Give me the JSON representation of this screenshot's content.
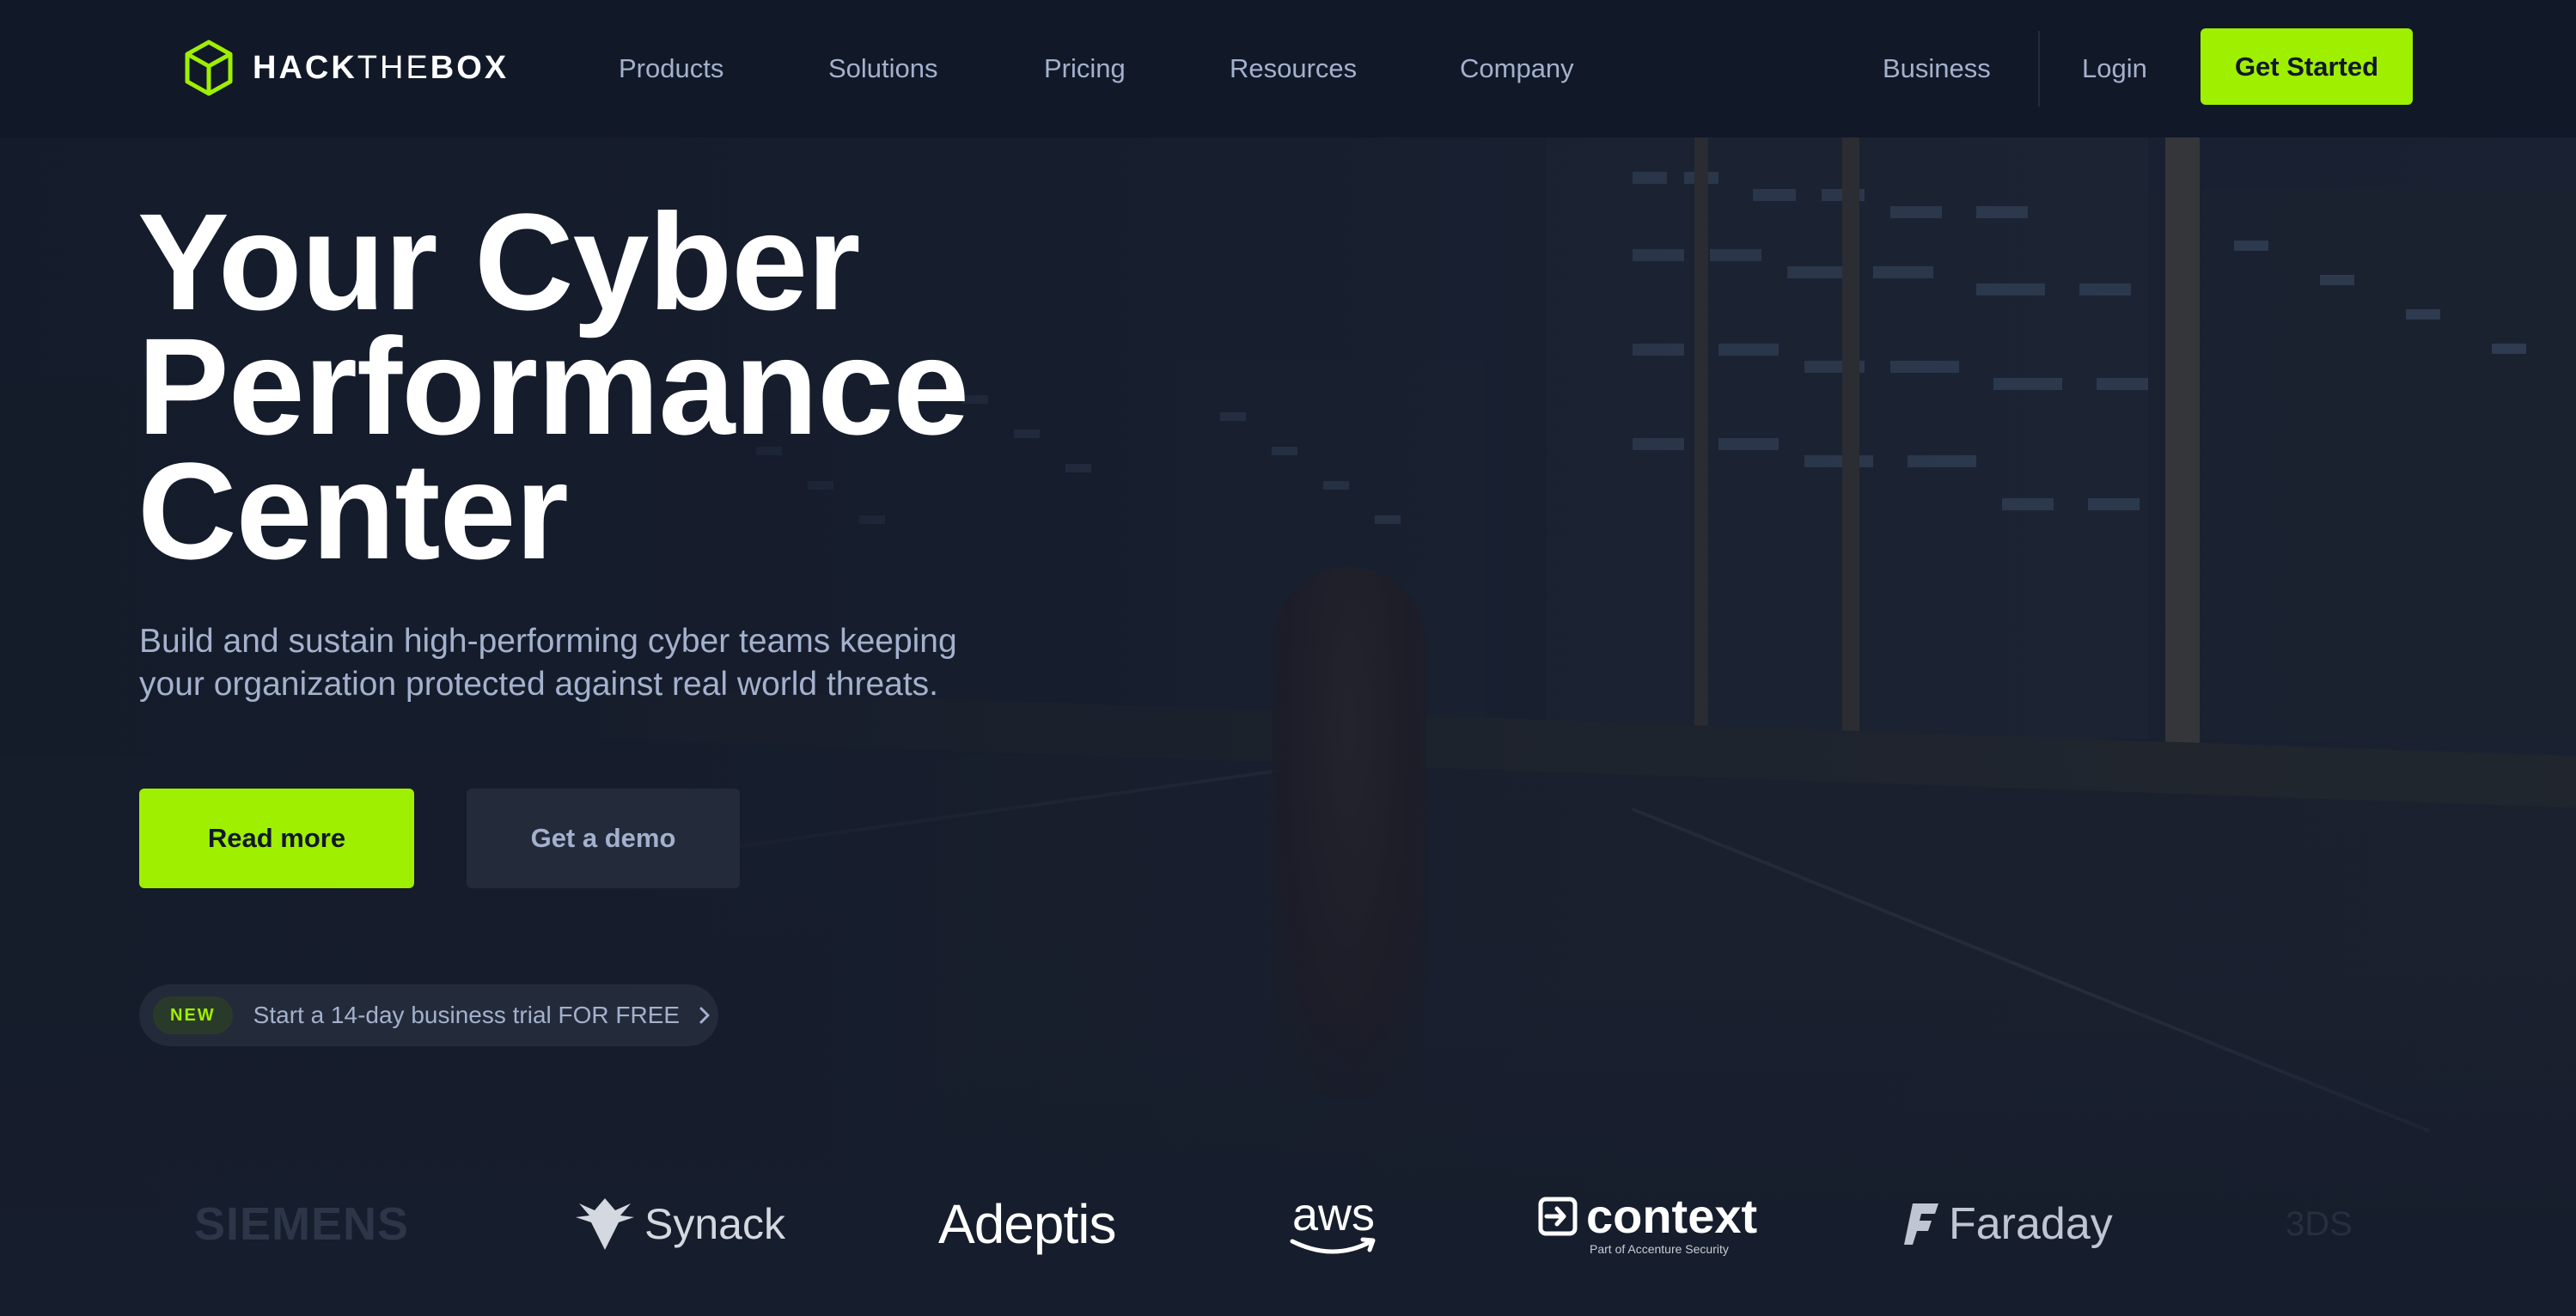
{
  "nav": {
    "logo": {
      "bold": "HACK",
      "light": "THE",
      "bold2": "BOX"
    },
    "links": [
      "Products",
      "Solutions",
      "Pricing",
      "Resources",
      "Company"
    ],
    "business": "Business",
    "login": "Login",
    "get_started": "Get Started"
  },
  "hero": {
    "title_lines": [
      "Your Cyber",
      "Performance",
      "Center"
    ],
    "subtitle_lines": [
      "Build and sustain high-performing cyber teams keeping",
      "your organization protected against real world threats."
    ],
    "read_more": "Read more",
    "get_demo": "Get a demo",
    "trial": {
      "badge": "NEW",
      "text": "Start a 14-day business trial FOR FREE"
    }
  },
  "partners": {
    "siemens": "SIEMENS",
    "synack": "Synack",
    "adeptis": "Adeptis",
    "aws": "aws",
    "context": "context",
    "context_sub": "Part of Accenture Security",
    "faraday": "Faraday",
    "dassault": "3DS"
  },
  "colors": {
    "accent": "#9fef00",
    "nav_bg": "#111828",
    "page_bg": "#161d2c",
    "muted_text": "#a4b1cd"
  },
  "icons": {
    "logo": "hackthebox-cube-icon",
    "trial_arrow": "chevron-right-icon"
  }
}
